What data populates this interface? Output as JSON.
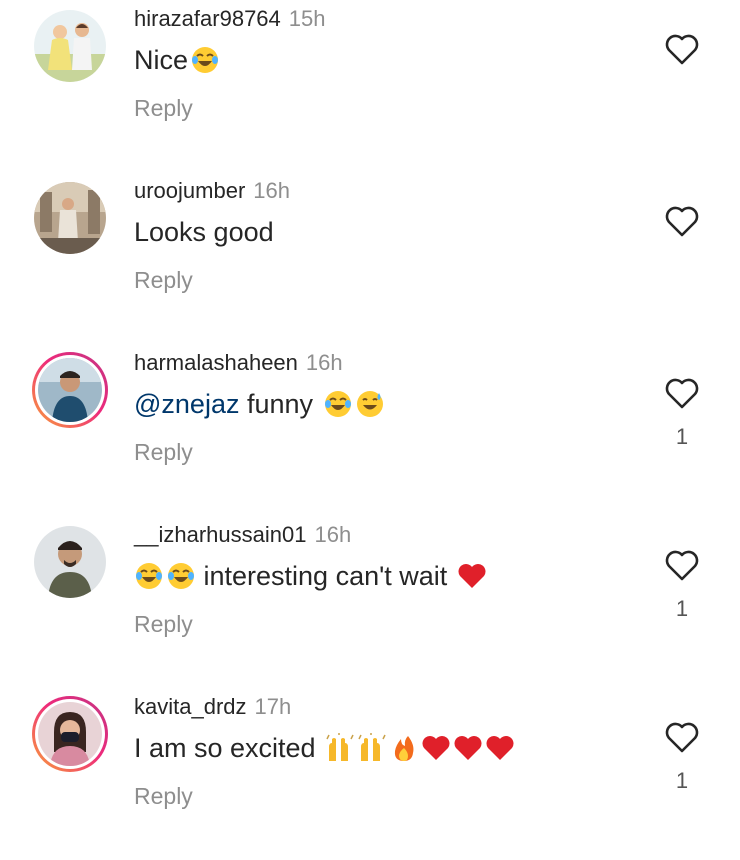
{
  "comments": [
    {
      "username": "hirazafar98764",
      "time": "15h",
      "text": "Nice",
      "emojis": [
        "laughing-tears-emoji"
      ],
      "reply_label": "Reply",
      "like_count": "",
      "story_ring": false
    },
    {
      "username": "uroojumber",
      "time": "16h",
      "text": "Looks good",
      "emojis": [],
      "reply_label": "Reply",
      "like_count": "",
      "story_ring": false
    },
    {
      "username": "harmalashaheen",
      "time": "16h",
      "mention": "@znejaz",
      "text": " funny ",
      "emojis": [
        "laughing-tears-emoji",
        "grinning-sweat-emoji"
      ],
      "reply_label": "Reply",
      "like_count": "1",
      "story_ring": true
    },
    {
      "username": "__izharhussain01",
      "time": "16h",
      "emojis_before": [
        "laughing-tears-emoji",
        "laughing-tears-emoji"
      ],
      "text": " interesting can't wait ",
      "emojis": [
        "red-heart-emoji"
      ],
      "reply_label": "Reply",
      "like_count": "1",
      "story_ring": false
    },
    {
      "username": "kavita_drdz",
      "time": "17h",
      "text": "I am so excited ",
      "emojis": [
        "raising-hands-emoji",
        "raising-hands-emoji",
        "fire-emoji",
        "red-heart-emoji",
        "red-heart-emoji",
        "red-heart-emoji"
      ],
      "reply_label": "Reply",
      "like_count": "1",
      "story_ring": true
    }
  ],
  "colors": {
    "text": "#262626",
    "muted": "#8e8e8e",
    "mention": "#00376b",
    "story_ring_start": "#f9a23a",
    "story_ring_end": "#c13584"
  },
  "icons": {
    "like": "heart-outline-icon"
  }
}
